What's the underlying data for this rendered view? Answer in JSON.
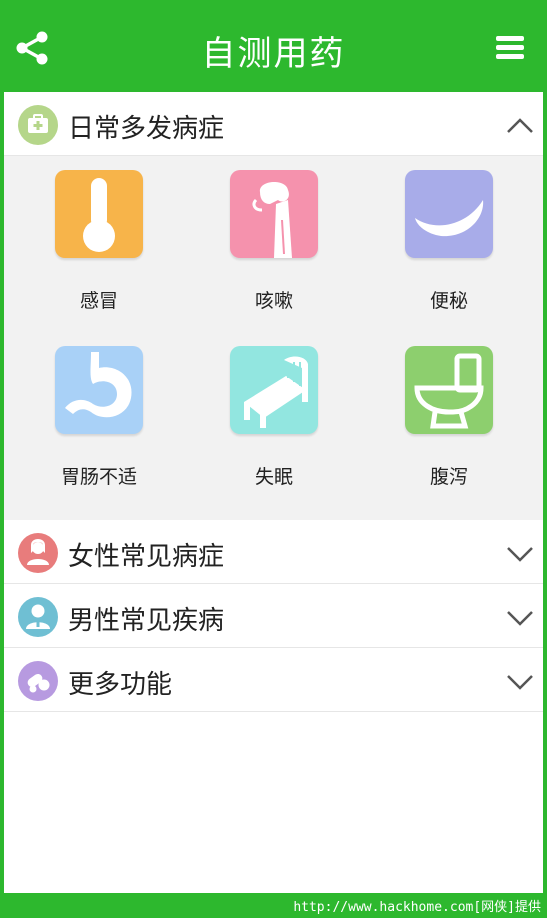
{
  "header": {
    "title": "自测用药"
  },
  "sections": [
    {
      "label": "日常多发病症",
      "color": "#b5d68a",
      "expanded": true
    },
    {
      "label": "女性常见病症",
      "color": "#e87c7c",
      "expanded": false
    },
    {
      "label": "男性常见疾病",
      "color": "#6fbfd3",
      "expanded": false
    },
    {
      "label": "更多功能",
      "color": "#b79ae0",
      "expanded": false
    }
  ],
  "conditions": [
    {
      "label": "感冒",
      "icon": "thermometer-icon",
      "color": "#f7b44a"
    },
    {
      "label": "咳嗽",
      "icon": "cough-icon",
      "color": "#f592ad"
    },
    {
      "label": "便秘",
      "icon": "banana-icon",
      "color": "#a8ace9"
    },
    {
      "label": "胃肠不适",
      "icon": "stomach-icon",
      "color": "#a9d1f7"
    },
    {
      "label": "失眠",
      "icon": "bed-icon",
      "color": "#92e6e0"
    },
    {
      "label": "腹泻",
      "icon": "toilet-icon",
      "color": "#8dcf6e"
    }
  ],
  "footer": {
    "watermark": "http://www.hackhome.com[网侠]提供"
  },
  "colors": {
    "brand": "#2db82e"
  }
}
